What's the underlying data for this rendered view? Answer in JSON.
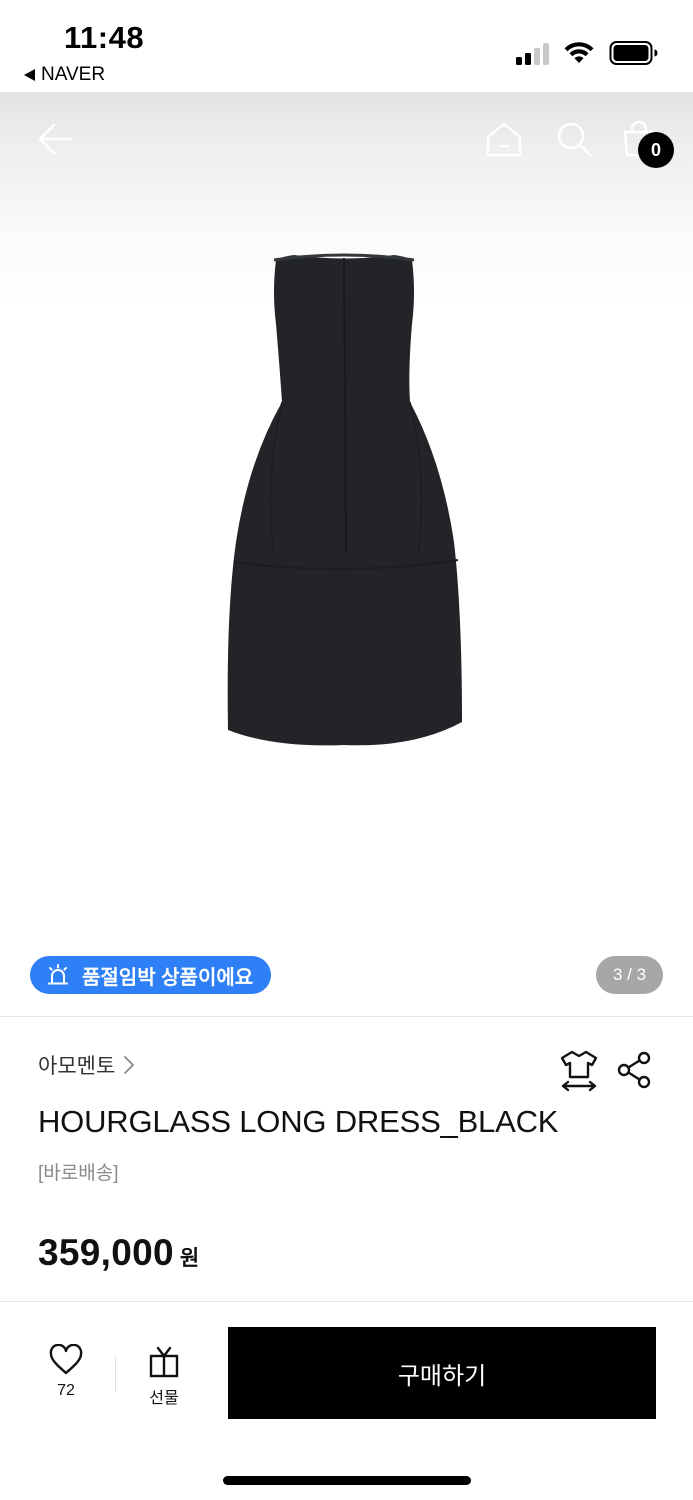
{
  "status_bar": {
    "time": "11:48",
    "back_app": "NAVER",
    "icons": [
      "cellular-signal-icon",
      "wifi-icon",
      "battery-icon"
    ]
  },
  "header": {
    "back_icon": "arrow-left-icon",
    "home_icon": "home-icon",
    "search_icon": "search-icon",
    "cart_icon": "shopping-bag-icon",
    "cart_count": "0"
  },
  "gallery": {
    "image_subject": "black sleeveless long dress",
    "stock_alert_icon": "alarm-light-icon",
    "stock_alert": "품절임박 상품이에요",
    "page_indicator": "3 / 3",
    "colors": {
      "alert": "#2f80f6",
      "indicator": "#a7a7a7"
    }
  },
  "product": {
    "brand": "아모멘토",
    "brand_chevron_icon": "chevron-right-icon",
    "size_guide_icon": "size-guide-icon",
    "share_icon": "share-icon",
    "name": "HOURGLASS LONG DRESS_BLACK",
    "delivery_tag": "[바로배송]",
    "price": "359,000",
    "currency": "원"
  },
  "bottom_bar": {
    "like_icon": "heart-icon",
    "like_count": "72",
    "gift_icon": "gift-icon",
    "gift_label": "선물",
    "buy_label": "구매하기"
  }
}
